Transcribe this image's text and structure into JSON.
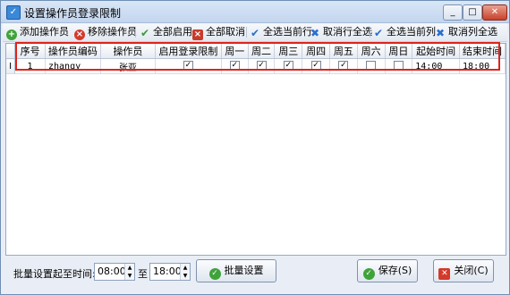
{
  "window": {
    "title": "设置操作员登录限制"
  },
  "toolbar": {
    "add_operator": "添加操作员",
    "remove_operator": "移除操作员",
    "enable_all": "全部启用",
    "cancel_all": "全部取消",
    "select_row": "全选当前行",
    "deselect_row": "取消行全选",
    "select_column": "全选当前列",
    "deselect_column": "取消列全选"
  },
  "grid": {
    "columns": [
      "序号",
      "操作员编码",
      "操作员",
      "启用登录限制",
      "周一",
      "周二",
      "周三",
      "周四",
      "周五",
      "周六",
      "周日",
      "起始时间",
      "结束时间"
    ],
    "rows": [
      {
        "row_marker": "I",
        "no": "1",
        "code": "zhangy",
        "name": "张亚",
        "enabled": "✓",
        "mon": "✓",
        "tue": "✓",
        "wed": "✓",
        "thu": "✓",
        "fri": "✓",
        "sat": "",
        "sun": "",
        "start": "14:00",
        "end": "18:00"
      }
    ]
  },
  "bottom": {
    "batch_label": "批量设置起至时间:",
    "from_time": "08:00",
    "to_label": "至",
    "to_time": "18:00",
    "batch_button": "批量设置",
    "save_button": "保存(S)",
    "close_button": "关闭(C)"
  }
}
